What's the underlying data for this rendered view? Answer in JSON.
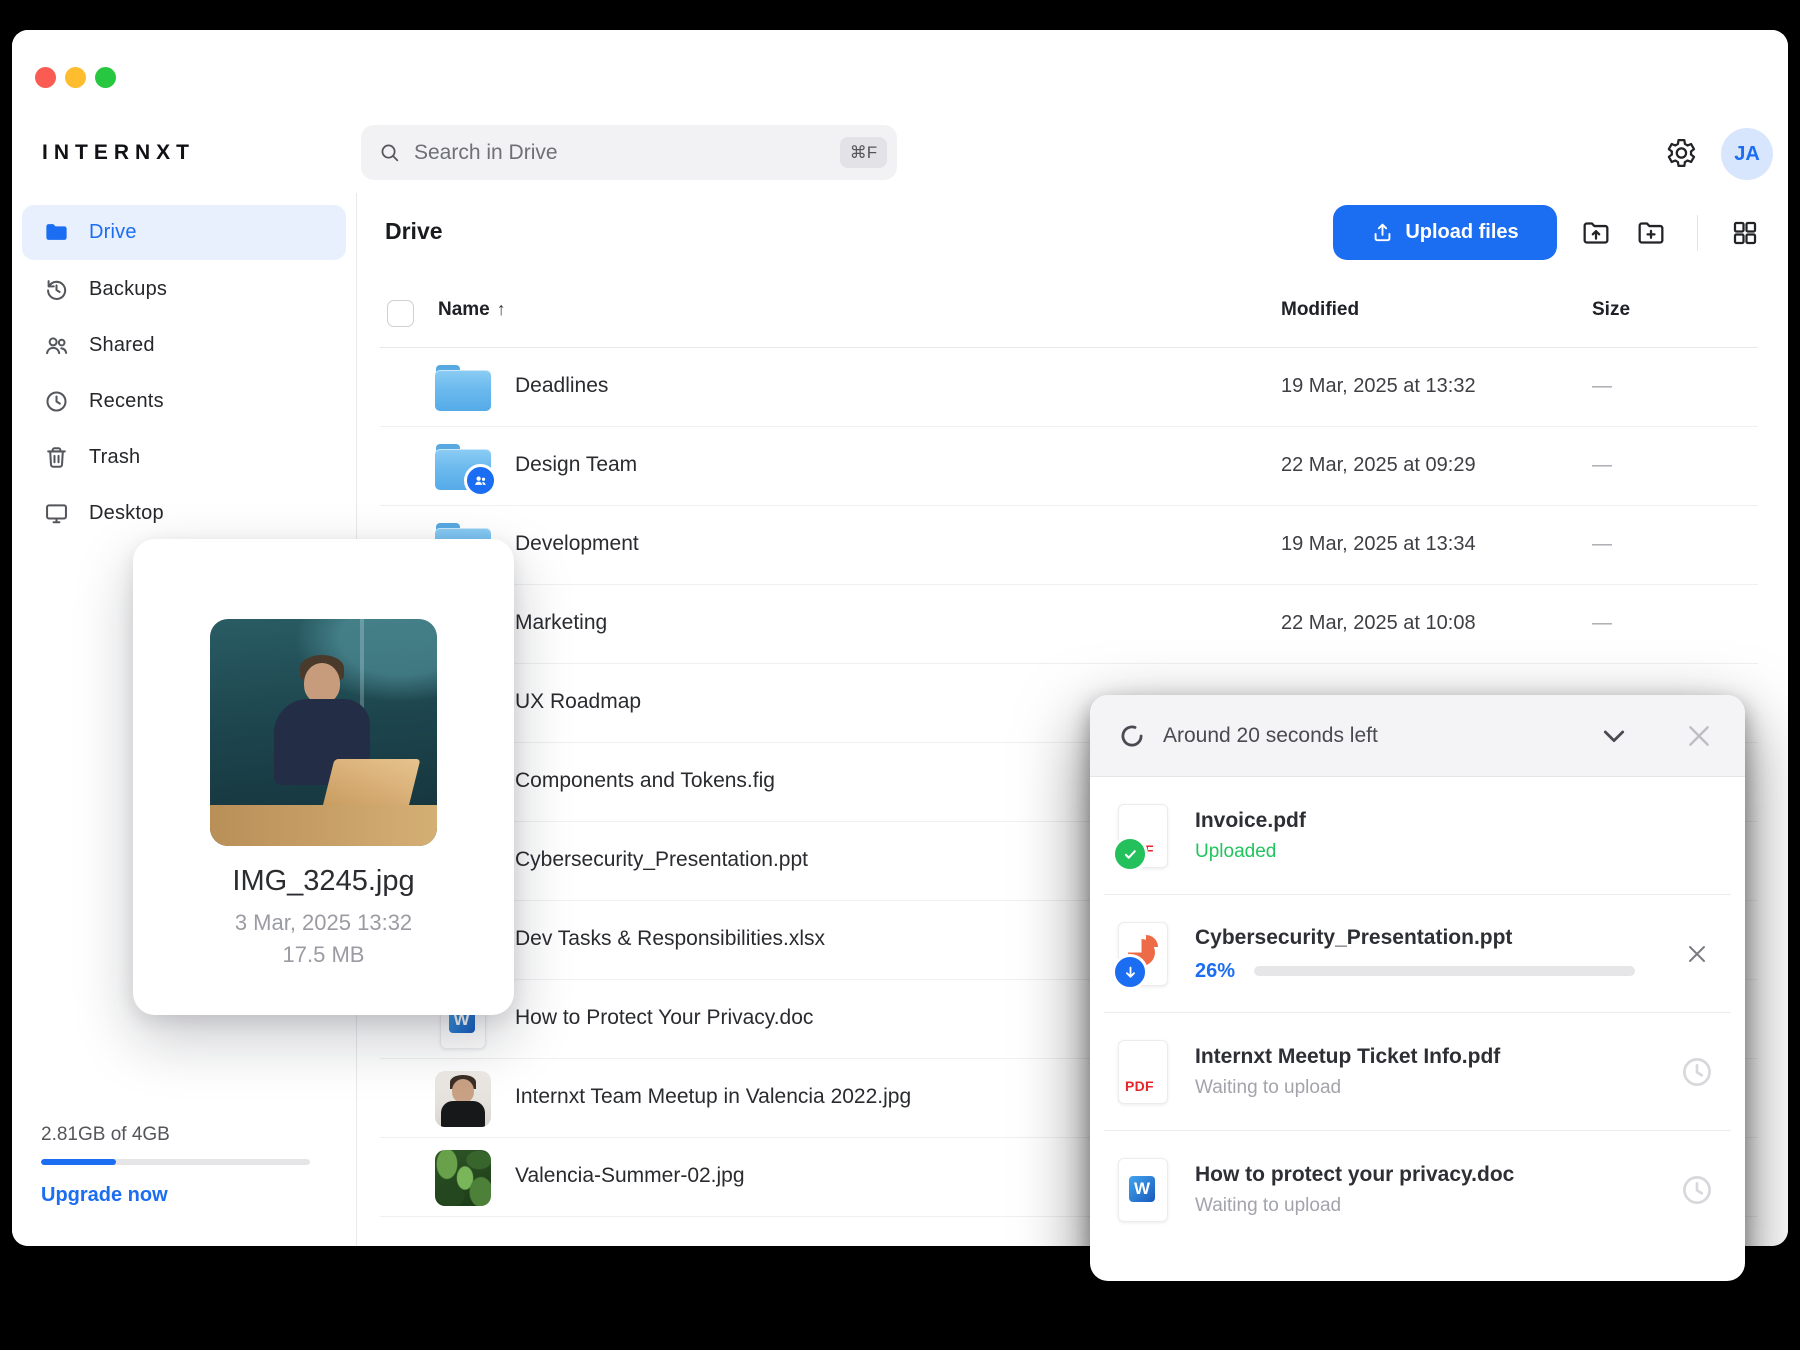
{
  "brand": {
    "logo": "INTERNXT",
    "avatar_initials": "JA"
  },
  "search": {
    "placeholder": "Search in Drive",
    "shortcut": "⌘F"
  },
  "sidebar": {
    "items": [
      {
        "label": "Drive",
        "icon": "folder-filled",
        "active": true
      },
      {
        "label": "Backups",
        "icon": "history",
        "active": false
      },
      {
        "label": "Shared",
        "icon": "people",
        "active": false
      },
      {
        "label": "Recents",
        "icon": "clock",
        "active": false
      },
      {
        "label": "Trash",
        "icon": "trash",
        "active": false
      },
      {
        "label": "Desktop",
        "icon": "desktop",
        "active": false
      }
    ],
    "storage": {
      "usage": "2.81GB of 4GB",
      "bar_percent": 28,
      "upgrade_label": "Upgrade now"
    }
  },
  "toolbar": {
    "title": "Drive",
    "upload_label": "Upload files"
  },
  "table": {
    "columns": {
      "name": "Name",
      "modified": "Modified",
      "size": "Size"
    },
    "sort_arrow": "↑",
    "rows": [
      {
        "name": "Deadlines",
        "icon": "folder",
        "modified": "19 Mar, 2025 at 13:32",
        "size": "—"
      },
      {
        "name": "Design Team",
        "icon": "folder-shared",
        "modified": "22 Mar, 2025 at 09:29",
        "size": "—"
      },
      {
        "name": "Development",
        "icon": "folder",
        "modified": "19 Mar, 2025 at 13:34",
        "size": "—"
      },
      {
        "name": "Marketing",
        "icon": "folder",
        "modified": "22 Mar, 2025 at 10:08",
        "size": "—"
      },
      {
        "name": "UX Roadmap",
        "icon": "folder",
        "modified": "",
        "size": ""
      },
      {
        "name": "Components and Tokens.fig",
        "icon": "file",
        "modified": "",
        "size": ""
      },
      {
        "name": "Cybersecurity_Presentation.ppt",
        "icon": "file",
        "modified": "",
        "size": ""
      },
      {
        "name": "Dev Tasks & Responsibilities.xlsx",
        "icon": "file",
        "modified": "",
        "size": ""
      },
      {
        "name": "How to Protect Your Privacy.doc",
        "icon": "word",
        "modified": "",
        "size": ""
      },
      {
        "name": "Internxt Team Meetup in Valencia 2022.jpg",
        "icon": "photo-portrait",
        "modified": "",
        "size": ""
      },
      {
        "name": "Valencia-Summer-02.jpg",
        "icon": "photo-leaves",
        "modified": "",
        "size": ""
      }
    ]
  },
  "preview_card": {
    "filename": "IMG_3245.jpg",
    "date": "3 Mar, 2025 13:32",
    "size": "17.5 MB"
  },
  "upload_panel": {
    "title": "Around 20 seconds left",
    "items": [
      {
        "name": "Invoice.pdf",
        "icon": "pdf",
        "state": "done",
        "status": "Uploaded"
      },
      {
        "name": "Cybersecurity_Presentation.ppt",
        "icon": "ppt",
        "state": "uploading",
        "progress_label": "26%",
        "progress_percent": 26,
        "closable": true
      },
      {
        "name": "Internxt Meetup Ticket Info.pdf",
        "icon": "pdf",
        "state": "waiting",
        "status": "Waiting to upload"
      },
      {
        "name": "How to protect your privacy.doc",
        "icon": "word",
        "state": "waiting",
        "status": "Waiting to upload"
      }
    ]
  },
  "colors": {
    "accent": "#1b6df2",
    "success": "#21c45d",
    "pdf_red": "#e5252a",
    "ppt_orange": "#ed6c47"
  }
}
